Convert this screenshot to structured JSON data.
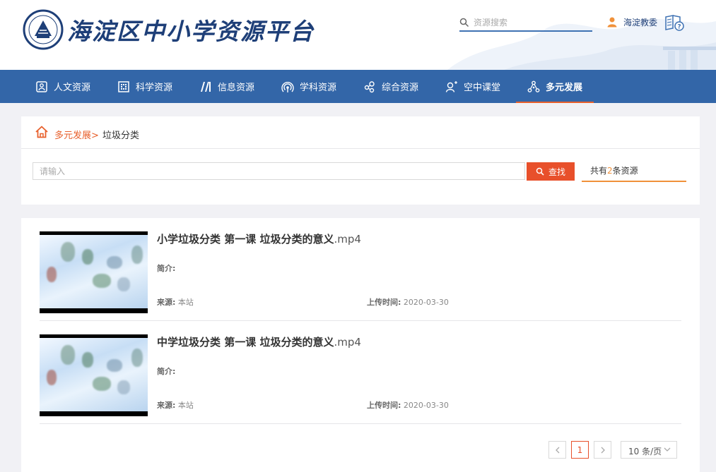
{
  "header": {
    "site_title": "海淀区中小学资源平台",
    "search_placeholder": "资源搜索",
    "user_name": "海淀教委"
  },
  "nav": {
    "items": [
      {
        "label": "人文资源",
        "icon": "humanities-icon"
      },
      {
        "label": "科学资源",
        "icon": "science-icon"
      },
      {
        "label": "信息资源",
        "icon": "information-icon"
      },
      {
        "label": "学科资源",
        "icon": "subject-icon"
      },
      {
        "label": "综合资源",
        "icon": "comprehensive-icon"
      },
      {
        "label": "空中课堂",
        "icon": "online-class-icon"
      },
      {
        "label": "多元发展",
        "icon": "diverse-development-icon",
        "active": true
      }
    ]
  },
  "breadcrumb": {
    "parent": "多元发展>",
    "current": "垃圾分类"
  },
  "filter": {
    "input_placeholder": "请输入",
    "find_label": "查找",
    "total_prefix": "共有",
    "total_count": "2",
    "total_suffix": "条资源"
  },
  "results": [
    {
      "title": "小学垃圾分类 第一课 垃圾分类的意义",
      "ext": ".mp4",
      "summary_label": "简介:",
      "source_label": "来源:",
      "source": "本站",
      "date_label": "上传时间:",
      "date": "2020-03-30"
    },
    {
      "title": "中学垃圾分类 第一课 垃圾分类的意义",
      "ext": ".mp4",
      "summary_label": "简介:",
      "source_label": "来源:",
      "source": "本站",
      "date_label": "上传时间:",
      "date": "2020-03-30"
    }
  ],
  "pagination": {
    "current_page": "1",
    "page_size": "10 条/页"
  },
  "colors": {
    "nav_bg": "#3366a8",
    "accent": "#e8502b",
    "count_accent": "#f0913a",
    "brand_text": "#1e3f78"
  }
}
